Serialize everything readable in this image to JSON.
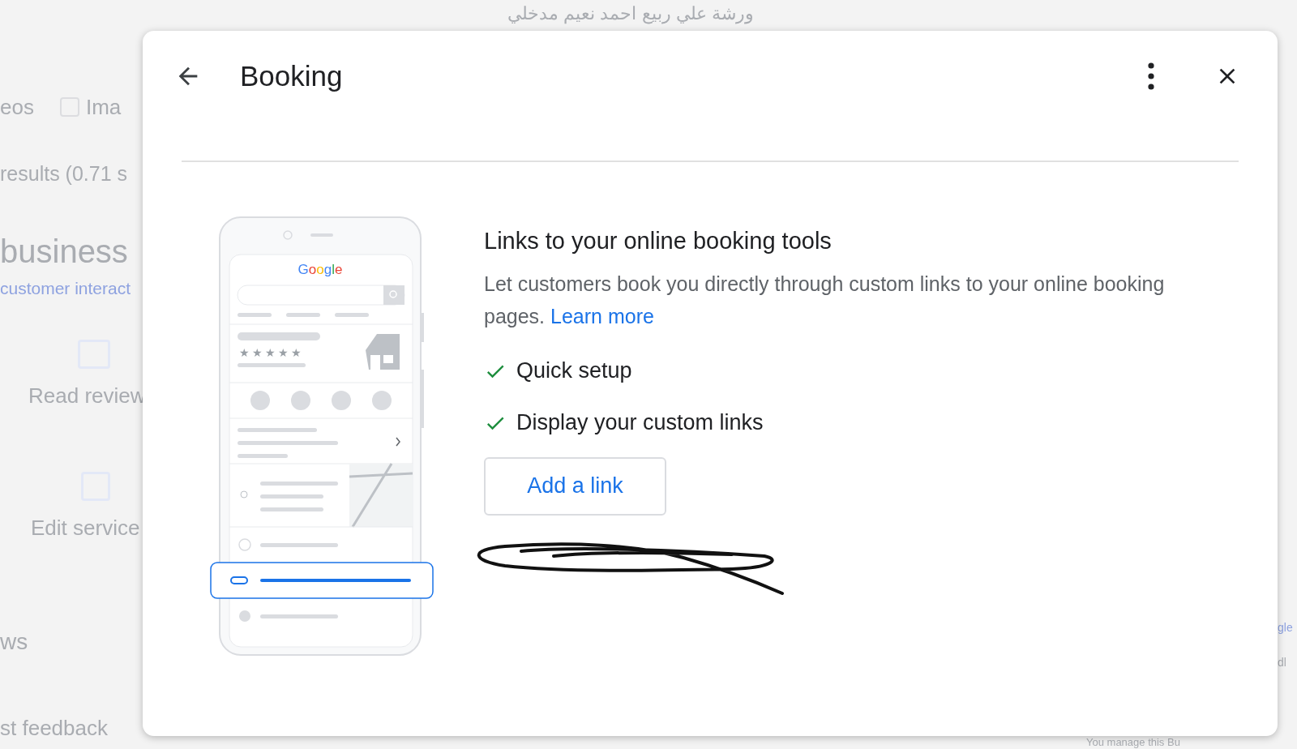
{
  "background": {
    "search_query": "ورشة علي ربيع احمد نعيم مدخلي",
    "tabs": [
      "eos",
      "Ima"
    ],
    "result_stats": "results (0.71 s",
    "heading": "business",
    "subheading": "customer interact",
    "actions": [
      "Read review",
      "Edit service"
    ],
    "section_title": "ws",
    "feedback": "st feedback",
    "managed_note": "You manage this Bu",
    "side_fragments": [
      "gle",
      "dl"
    ]
  },
  "dialog": {
    "title": "Booking",
    "illustration": {
      "logo": "Google",
      "stars": 5
    },
    "heading": "Links to your online booking tools",
    "description": "Let customers book you directly through custom links to your online booking pages.",
    "learn_more": "Learn more",
    "features": [
      "Quick setup",
      "Display your custom links"
    ],
    "button": "Add a link"
  }
}
